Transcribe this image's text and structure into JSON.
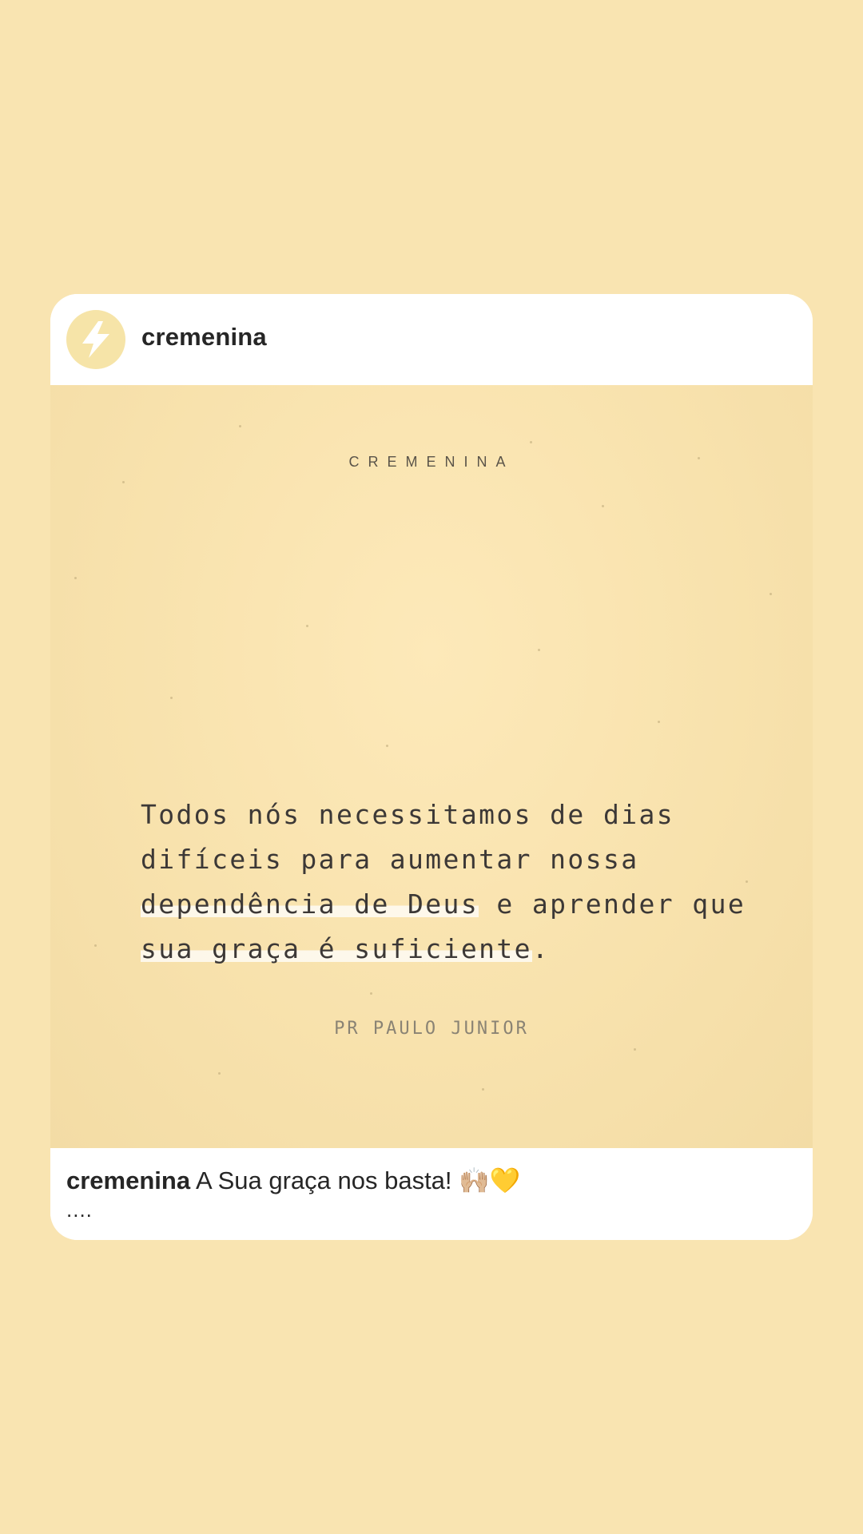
{
  "post": {
    "username": "cremenina",
    "avatar_icon": "lightning-bolt-icon",
    "image": {
      "brand_text": "CREMENINA",
      "quote_part1": "Todos nós necessitamos de dias difíceis para aumentar nossa ",
      "quote_highlight1": "dependência de Deus",
      "quote_part2": " e aprender que ",
      "quote_highlight2": "sua graça é suficiente",
      "quote_end": ".",
      "author": "PR PAULO JUNIOR"
    },
    "caption": {
      "username": "cremenina",
      "text": "A Sua graça nos basta! 🙌🏼💛",
      "more": "...."
    }
  },
  "colors": {
    "background": "#f9e4b1",
    "card": "#ffffff",
    "avatar_bg": "#f6e4a8",
    "quote_text": "#3c3836"
  }
}
